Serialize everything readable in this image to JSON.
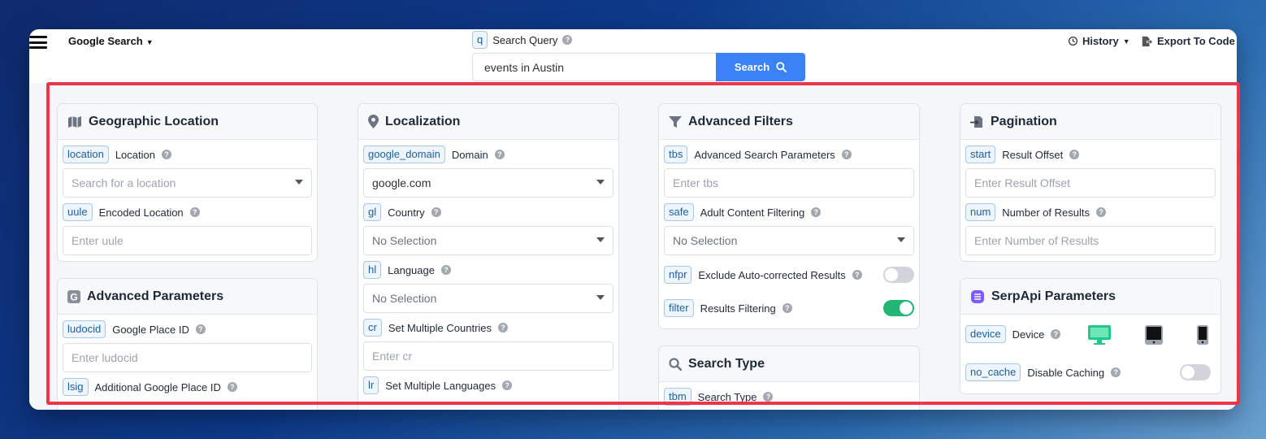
{
  "header": {
    "engine_label": "Google Search",
    "query_tag": "q",
    "query_label": "Search Query",
    "query_value": "events in Austin",
    "search_button": "Search",
    "history_label": "History",
    "export_label": "Export To Code"
  },
  "geo": {
    "title": "Geographic Location",
    "location_tag": "location",
    "location_label": "Location",
    "location_placeholder": "Search for a location",
    "uule_tag": "uule",
    "uule_label": "Encoded Location",
    "uule_placeholder": "Enter uule"
  },
  "advanced": {
    "title": "Advanced Parameters",
    "ludocid_tag": "ludocid",
    "ludocid_label": "Google Place ID",
    "ludocid_placeholder": "Enter ludocid",
    "lsig_tag": "lsig",
    "lsig_label": "Additional Google Place ID"
  },
  "localization": {
    "title": "Localization",
    "domain_tag": "google_domain",
    "domain_label": "Domain",
    "domain_value": "google.com",
    "gl_tag": "gl",
    "gl_label": "Country",
    "gl_value": "No Selection",
    "hl_tag": "hl",
    "hl_label": "Language",
    "hl_value": "No Selection",
    "cr_tag": "cr",
    "cr_label": "Set Multiple Countries",
    "cr_placeholder": "Enter cr",
    "lr_tag": "lr",
    "lr_label": "Set Multiple Languages"
  },
  "filters": {
    "title": "Advanced Filters",
    "tbs_tag": "tbs",
    "tbs_label": "Advanced Search Parameters",
    "tbs_placeholder": "Enter tbs",
    "safe_tag": "safe",
    "safe_label": "Adult Content Filtering",
    "safe_value": "No Selection",
    "nfpr_tag": "nfpr",
    "nfpr_label": "Exclude Auto-corrected Results",
    "nfpr_on": false,
    "filter_tag": "filter",
    "filter_label": "Results Filtering",
    "filter_on": true
  },
  "search_type": {
    "title": "Search Type",
    "tbm_tag": "tbm",
    "tbm_label": "Search Type"
  },
  "pagination": {
    "title": "Pagination",
    "start_tag": "start",
    "start_label": "Result Offset",
    "start_placeholder": "Enter Result Offset",
    "num_tag": "num",
    "num_label": "Number of Results",
    "num_placeholder": "Enter Number of Results"
  },
  "serpapi": {
    "title": "SerpApi Parameters",
    "device_tag": "device",
    "device_label": "Device",
    "devices": [
      "desktop-icon",
      "tablet-icon",
      "mobile-icon"
    ],
    "selected_device": "desktop",
    "no_cache_tag": "no_cache",
    "no_cache_label": "Disable Caching",
    "no_cache_on": false
  },
  "colors": {
    "accent": "#3b82f6",
    "toggle_on": "#22b573",
    "highlight": "#f0344a",
    "tag_text": "#1c5f9e"
  }
}
